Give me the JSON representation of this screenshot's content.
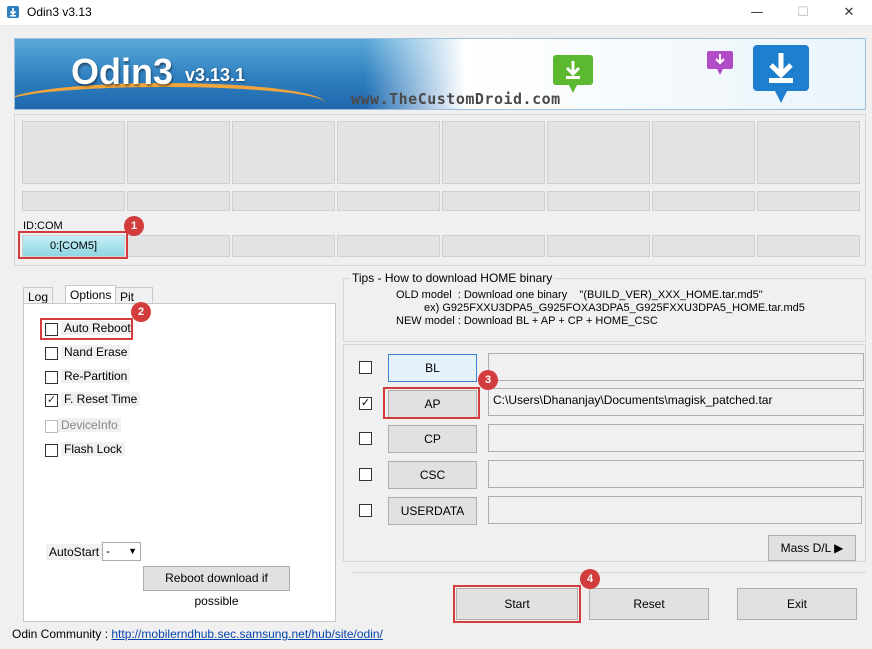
{
  "window": {
    "title": "Odin3 v3.13",
    "minimize": "—",
    "maximize": "☐",
    "close": "✕"
  },
  "banner": {
    "logo": "Odin3",
    "version": "v3.13.1",
    "site": "www.TheCustomDroid.com"
  },
  "device": {
    "id_label": "ID:COM",
    "com_port": "0:[COM5]"
  },
  "tabs": {
    "log": "Log",
    "options": "Options",
    "pit": "Pit"
  },
  "options": [
    {
      "label": "Auto Reboot",
      "checked": false,
      "enabled": true
    },
    {
      "label": "Nand Erase",
      "checked": false,
      "enabled": true
    },
    {
      "label": "Re-Partition",
      "checked": false,
      "enabled": true
    },
    {
      "label": "F. Reset Time",
      "checked": true,
      "enabled": true
    },
    {
      "label": "DeviceInfo",
      "checked": false,
      "enabled": false
    },
    {
      "label": "Flash Lock",
      "checked": false,
      "enabled": true
    }
  ],
  "autostart": {
    "label": "AutoStart",
    "value": "-"
  },
  "reboot_button": "Reboot download if possible",
  "tips": {
    "title": "Tips - How to download HOME binary",
    "line1": "OLD model  : Download one binary    \"(BUILD_VER)_XXX_HOME.tar.md5\"",
    "line2": "ex) G925FXXU3DPA5_G925FOXA3DPA5_G925FXXU3DPA5_HOME.tar.md5",
    "line3": "NEW model : Download BL + AP + CP + HOME_CSC"
  },
  "files": [
    {
      "button": "BL",
      "checked": false,
      "path": ""
    },
    {
      "button": "AP",
      "checked": true,
      "path": "C:\\Users\\Dhananjay\\Documents\\magisk_patched.tar"
    },
    {
      "button": "CP",
      "checked": false,
      "path": ""
    },
    {
      "button": "CSC",
      "checked": false,
      "path": ""
    },
    {
      "button": "USERDATA",
      "checked": false,
      "path": ""
    }
  ],
  "mass_dl": "Mass D/L ▶",
  "actions": {
    "start": "Start",
    "reset": "Reset",
    "exit": "Exit"
  },
  "community": {
    "label": "Odin Community : ",
    "url": "http://mobilerndhub.sec.samsung.net/hub/site/odin/"
  },
  "callouts": [
    "1",
    "2",
    "3",
    "4"
  ],
  "colors": {
    "callout_red": "#d23c3c",
    "com_active": "#8fd6e3",
    "link": "#0645ad",
    "banner_blue": "#2f7fc0"
  }
}
